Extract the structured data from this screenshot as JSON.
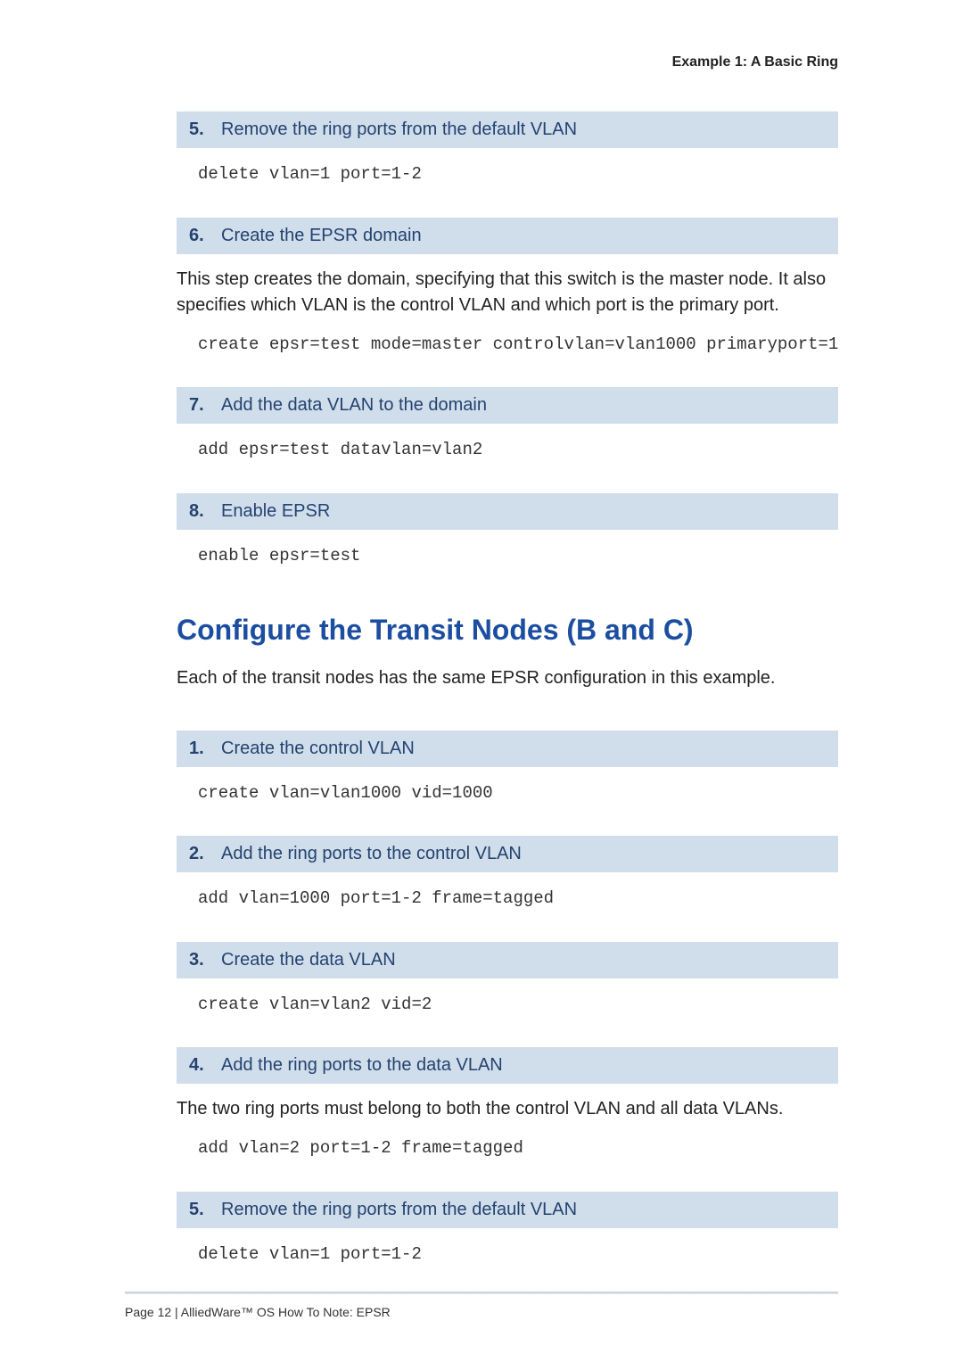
{
  "running_head": "Example 1: A Basic Ring",
  "sectionA": {
    "steps": [
      {
        "num": "5.",
        "title": "Remove the ring ports from the default VLAN",
        "code": "delete vlan=1 port=1-2"
      },
      {
        "num": "6.",
        "title": "Create the EPSR domain",
        "para": "This step creates the domain, specifying that this switch is the master node. It also specifies which VLAN is the control VLAN and which port is the primary port.",
        "code": "create epsr=test mode=master controlvlan=vlan1000 primaryport=1"
      },
      {
        "num": "7.",
        "title": "Add the data VLAN to the domain",
        "code": "add epsr=test datavlan=vlan2"
      },
      {
        "num": "8.",
        "title": "Enable EPSR",
        "code": "enable epsr=test"
      }
    ]
  },
  "h2": "Configure the Transit Nodes (B and C)",
  "intro": "Each of the transit nodes has the same EPSR configuration in this example.",
  "sectionB": {
    "steps": [
      {
        "num": "1.",
        "title": "Create the control VLAN",
        "code": "create vlan=vlan1000 vid=1000"
      },
      {
        "num": "2.",
        "title": "Add the ring ports to the control VLAN",
        "code": "add vlan=1000 port=1-2 frame=tagged"
      },
      {
        "num": "3.",
        "title": "Create the data VLAN",
        "code": "create vlan=vlan2 vid=2"
      },
      {
        "num": "4.",
        "title": "Add the ring ports to the data VLAN",
        "para": "The two ring ports must belong to both the control VLAN and all data VLANs.",
        "code": "add vlan=2 port=1-2 frame=tagged"
      },
      {
        "num": "5.",
        "title": "Remove the ring ports from the default VLAN",
        "code": "delete vlan=1 port=1-2"
      }
    ]
  },
  "footer": "Page 12 | AlliedWare™ OS How To Note: EPSR"
}
